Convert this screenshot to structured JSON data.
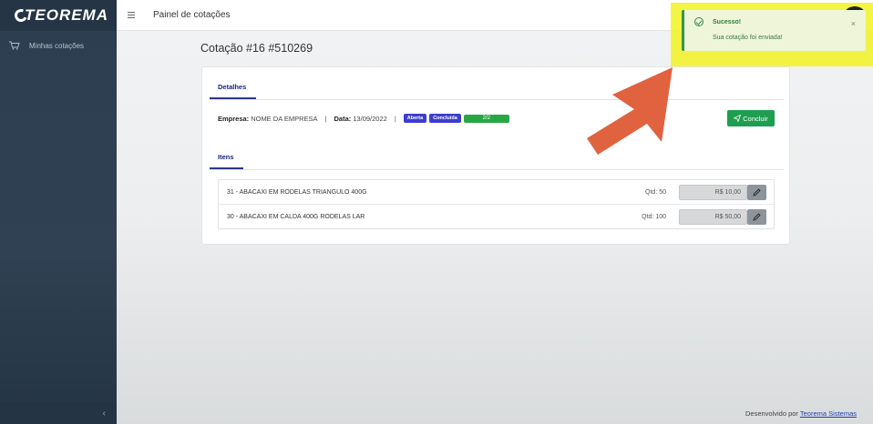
{
  "brand": {
    "name": "TEOREMA"
  },
  "sidebar": {
    "items": [
      {
        "label": "Minhas cotações",
        "icon": "cart-icon"
      }
    ],
    "collapse_icon": "chevron-left-icon"
  },
  "topbar": {
    "title": "Painel de cotações",
    "menu_icon": "hamburger-icon"
  },
  "page": {
    "title": "Cotação  #16 #510269"
  },
  "details": {
    "tab_label": "Detalhes",
    "empresa_label": "Empresa:",
    "empresa_value": "NOME DA EMPRESA",
    "data_label": "Data:",
    "data_value": "13/09/2022",
    "separator": "|",
    "badges": [
      "Aberta",
      "Concluída"
    ],
    "progress_text": "2/2",
    "progress_fraction": 1.0,
    "conclude_button": "Concluir"
  },
  "items": {
    "tab_label": "Itens",
    "rows": [
      {
        "name": "31 - ABACAXI EM RODELAS TRIANGULO 400G",
        "qty": "Qtd: 50",
        "price": "R$ 10,00"
      },
      {
        "name": "30 - ABACAXI EM CALDA 400G RODELAS LAR",
        "qty": "Qtd: 100",
        "price": "R$ 50,00"
      }
    ]
  },
  "toast": {
    "title": "Sucesso!",
    "message": "Sua cotação foi enviada!",
    "close": "×"
  },
  "footer": {
    "text": "Desenvolvido por",
    "link": "Teorema Sistemas"
  },
  "colors": {
    "sidebar": "#2c3e50",
    "accent": "#2c3794",
    "success": "#1e9e50",
    "highlight": "#f1f21c",
    "arrow": "#e0623f"
  }
}
